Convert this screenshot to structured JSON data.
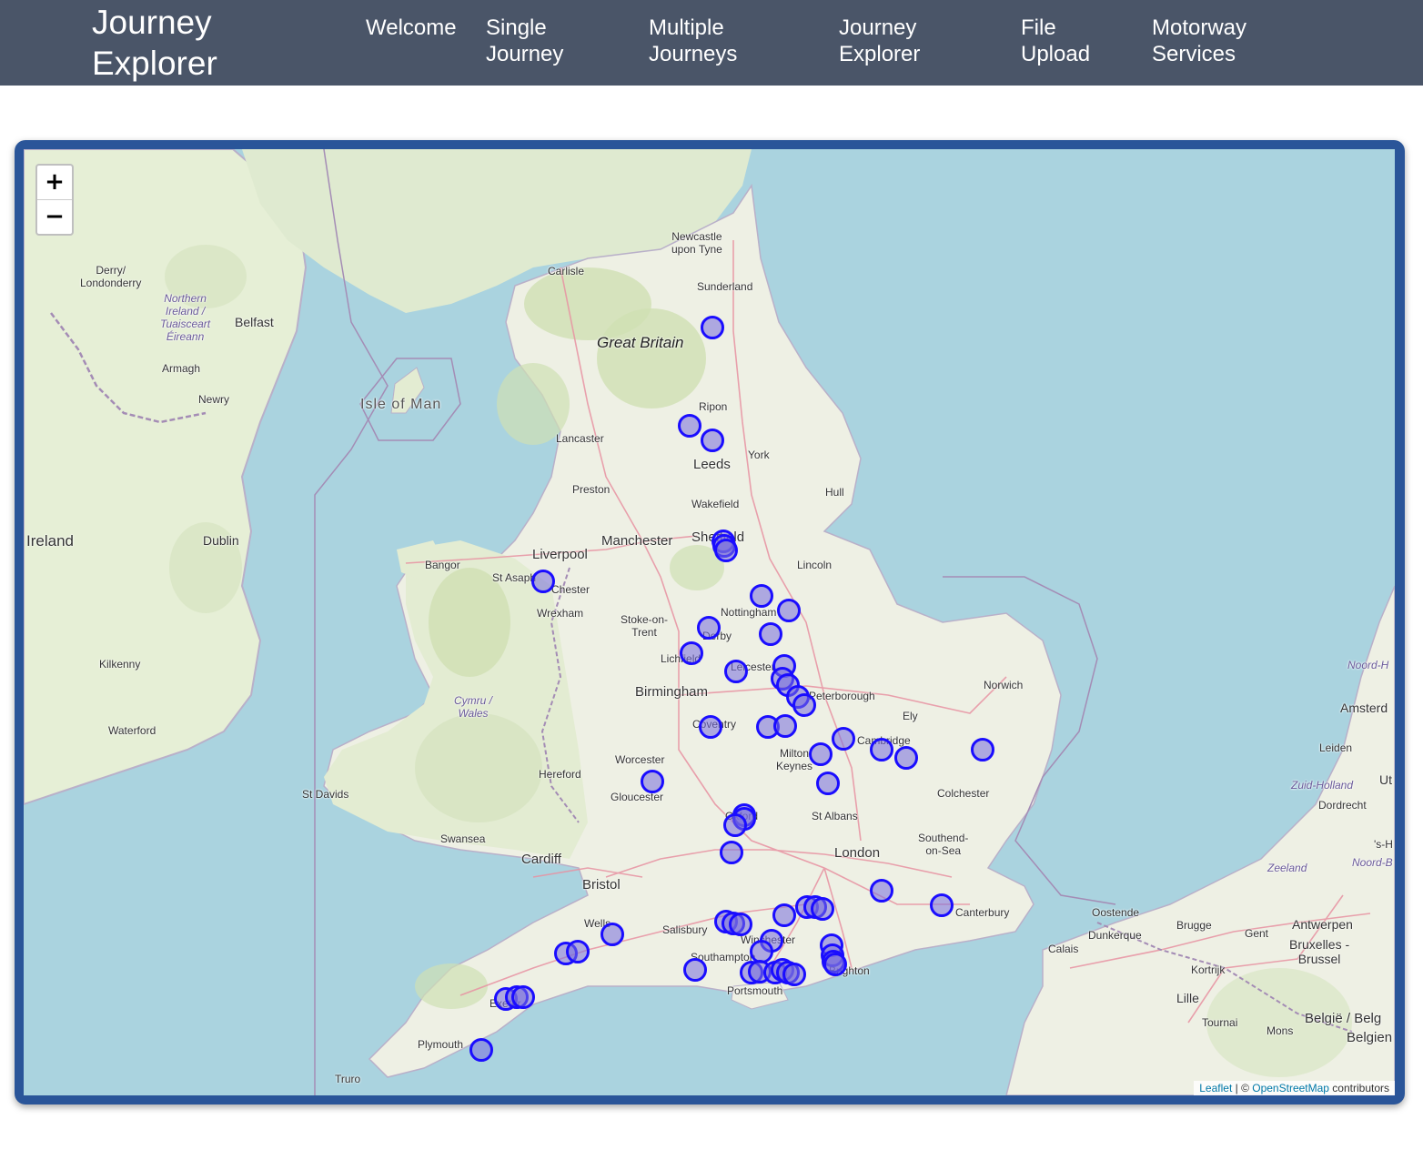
{
  "navbar": {
    "brand": "Journey\nExplorer",
    "links": [
      {
        "label": "Welcome"
      },
      {
        "label": "Single\nJourney"
      },
      {
        "label": "Multiple\nJourneys"
      },
      {
        "label": "Journey\nExplorer"
      },
      {
        "label": "File\nUpload"
      },
      {
        "label": "Motorway\nServices"
      }
    ]
  },
  "map": {
    "zoom_in": "+",
    "zoom_out": "−",
    "attribution": {
      "leaflet": "Leaflet",
      "separator": " | © ",
      "osm": "OpenStreetMap",
      "suffix": " contributors"
    },
    "labels": {
      "newcastle": "Newcastle\nupon Tyne",
      "sunderland": "Sunderland",
      "carlisle": "Carlisle",
      "derry": "Derry/\nLondonderry",
      "northern_ireland": "Northern\nIreland /\nTuaisceart\nÉireann",
      "belfast": "Belfast",
      "armagh": "Armagh",
      "newry": "Newry",
      "great_britain": "Great Britain",
      "isle_of_man": "Isle of Man",
      "ripon": "Ripon",
      "lancaster": "Lancaster",
      "york": "York",
      "leeds": "Leeds",
      "preston": "Preston",
      "wakefield": "Wakefield",
      "hull": "Hull",
      "ireland": "Ireland",
      "dublin": "Dublin",
      "manchester": "Manchester",
      "sheffield": "Sheffield",
      "liverpool": "Liverpool",
      "bangor": "Bangor",
      "st_asaph": "St Asaph",
      "chester": "Chester",
      "lincoln": "Lincoln",
      "wrexham": "Wrexham",
      "stoke": "Stoke-on-\nTrent",
      "nottingham": "Nottingham",
      "derby": "Derby",
      "kilkenny": "Kilkenny",
      "lichfield": "Lichfield",
      "leicester": "Leicester",
      "norwich": "Norwich",
      "birmingham": "Birmingham",
      "peterborough": "Peterborough",
      "cymru": "Cymru /\nWales",
      "ely": "Ely",
      "coventry": "Coventry",
      "waterford": "Waterford",
      "cambridge": "Cambridge",
      "worcester": "Worcester",
      "milton_keynes": "Milton\nKeynes",
      "hereford": "Hereford",
      "st_davids": "St Davids",
      "gloucester": "Gloucester",
      "colchester": "Colchester",
      "oxford": "Oxford",
      "st_albans": "St Albans",
      "swansea": "Swansea",
      "southend": "Southend-\non-Sea",
      "cardiff": "Cardiff",
      "london": "London",
      "bristol": "Bristol",
      "canterbury": "Canterbury",
      "wells": "Wells",
      "salisbury": "Salisbury",
      "winchester": "Winchester",
      "southampton": "Southampton",
      "brighton": "Brighton",
      "portsmouth": "Portsmouth",
      "exeter": "Exeter",
      "plymouth": "Plymouth",
      "truro": "Truro",
      "oostende": "Oostende",
      "brugge": "Brugge",
      "dunkerque": "Dunkerque",
      "calais": "Calais",
      "gent": "Gent",
      "antwerpen": "Antwerpen",
      "bruxelles": "Bruxelles -\nBrussel",
      "kortrijk": "Kortrijk",
      "lille": "Lille",
      "tournai": "Tournai",
      "mons": "Mons",
      "belgie": "België / Belg",
      "belgien": "Belgien",
      "noord_holland": "Noord-H",
      "amsterdam": "Amsterd",
      "leiden": "Leiden",
      "zuid_holland": "Zuid-Holland",
      "dordrecht": "Dordrecht",
      "utrecht": "Ut",
      "zeeland": "Zeeland",
      "noord_brabant": "Noord-B",
      "s_hertogenbosch": "'s-H"
    },
    "markers": [
      {
        "lat": 54.85,
        "lon": -1.52
      },
      {
        "lat": 54.24,
        "lon": -1.78
      },
      {
        "lat": 54.15,
        "lon": -1.52
      },
      {
        "lat": 53.52,
        "lon": -1.4
      },
      {
        "lat": 53.49,
        "lon": -1.38
      },
      {
        "lat": 53.46,
        "lon": -1.36
      },
      {
        "lat": 53.27,
        "lon": -3.45
      },
      {
        "lat": 53.18,
        "lon": -0.96
      },
      {
        "lat": 53.09,
        "lon": -0.65
      },
      {
        "lat": 52.98,
        "lon": -1.56
      },
      {
        "lat": 52.94,
        "lon": -0.85
      },
      {
        "lat": 52.82,
        "lon": -1.76
      },
      {
        "lat": 52.74,
        "lon": -0.7
      },
      {
        "lat": 52.71,
        "lon": -1.25
      },
      {
        "lat": 52.66,
        "lon": -0.72
      },
      {
        "lat": 52.62,
        "lon": -0.66
      },
      {
        "lat": 52.55,
        "lon": -0.54
      },
      {
        "lat": 52.5,
        "lon": -0.47
      },
      {
        "lat": 52.36,
        "lon": -1.54
      },
      {
        "lat": 52.36,
        "lon": -0.89
      },
      {
        "lat": 52.37,
        "lon": -0.69
      },
      {
        "lat": 52.29,
        "lon": -0.02
      },
      {
        "lat": 52.22,
        "lon": 0.42
      },
      {
        "lat": 52.17,
        "lon": 0.7
      },
      {
        "lat": 52.22,
        "lon": 1.57
      },
      {
        "lat": 52.19,
        "lon": -0.28
      },
      {
        "lat": 52.01,
        "lon": -0.2
      },
      {
        "lat": 52.02,
        "lon": -2.21
      },
      {
        "lat": 51.81,
        "lon": -1.16
      },
      {
        "lat": 51.79,
        "lon": -1.16
      },
      {
        "lat": 51.75,
        "lon": -1.26
      },
      {
        "lat": 51.58,
        "lon": -1.3
      },
      {
        "lat": 51.34,
        "lon": 0.41
      },
      {
        "lat": 51.25,
        "lon": 1.1
      },
      {
        "lat": 51.24,
        "lon": -0.44
      },
      {
        "lat": 51.24,
        "lon": -0.34
      },
      {
        "lat": 51.23,
        "lon": -0.26
      },
      {
        "lat": 51.19,
        "lon": -0.7
      },
      {
        "lat": 51.15,
        "lon": -1.36
      },
      {
        "lat": 51.14,
        "lon": -1.28
      },
      {
        "lat": 51.13,
        "lon": -1.2
      },
      {
        "lat": 51.03,
        "lon": -0.84
      },
      {
        "lat": 51.0,
        "lon": -0.16
      },
      {
        "lat": 50.94,
        "lon": -0.15
      },
      {
        "lat": 50.9,
        "lon": -0.14
      },
      {
        "lat": 50.88,
        "lon": -0.12
      },
      {
        "lat": 50.96,
        "lon": -0.96
      },
      {
        "lat": 50.85,
        "lon": -1.72
      },
      {
        "lat": 50.83,
        "lon": -1.07
      },
      {
        "lat": 50.84,
        "lon": -0.98
      },
      {
        "lat": 50.83,
        "lon": -0.8
      },
      {
        "lat": 50.85,
        "lon": -0.72
      },
      {
        "lat": 50.83,
        "lon": -0.66
      },
      {
        "lat": 50.82,
        "lon": -0.58
      },
      {
        "lat": 51.07,
        "lon": -2.66
      },
      {
        "lat": 50.95,
        "lon": -3.2
      },
      {
        "lat": 50.96,
        "lon": -3.06
      },
      {
        "lat": 50.67,
        "lon": -3.88
      },
      {
        "lat": 50.68,
        "lon": -3.76
      },
      {
        "lat": 50.68,
        "lon": -3.68
      },
      {
        "lat": 50.35,
        "lon": -4.16
      }
    ]
  }
}
